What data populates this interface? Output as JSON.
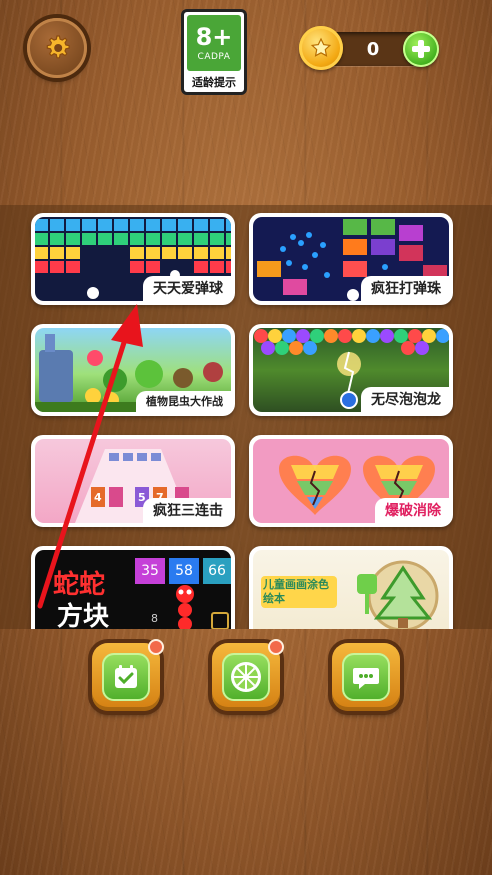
{
  "header": {
    "age_rating": "8+",
    "age_org": "CADPA",
    "age_hint": "适龄提示",
    "coin_count": "0"
  },
  "games": [
    {
      "title": "天天爱弹球"
    },
    {
      "title": "疯狂打弹珠"
    },
    {
      "title": "植物昆虫大作战"
    },
    {
      "title": "无尽泡泡龙"
    },
    {
      "title": "疯狂三连击"
    },
    {
      "title": "爆破消除"
    },
    {
      "title": "",
      "art_text_1": "蛇蛇",
      "art_text_2": "方块",
      "numbers": [
        "35",
        "58",
        "66"
      ],
      "small_number": "8"
    },
    {
      "title": "",
      "art_text": "儿童画画涂色绘本"
    }
  ],
  "bottom_nav": [
    {
      "icon": "calendar-check-icon",
      "has_badge": true
    },
    {
      "icon": "lemon-wheel-icon",
      "has_badge": true
    },
    {
      "icon": "chat-bubble-icon",
      "has_badge": false
    }
  ],
  "colors": {
    "wood": "#9a5e2e",
    "accent_green": "#4eae2a",
    "coin_gold": "#f3a913",
    "arrow_red": "#e8141c"
  }
}
